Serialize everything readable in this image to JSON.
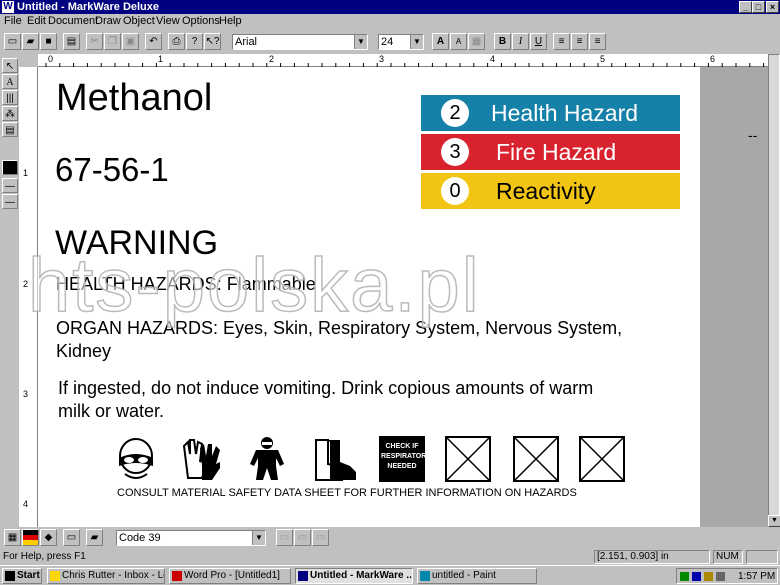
{
  "window": {
    "title": "Untitled - MarkWare Deluxe",
    "app_icon": "W"
  },
  "menu": [
    "File",
    "Edit",
    "Document",
    "Draw",
    "Object",
    "View",
    "Options",
    "Help"
  ],
  "toolbar": {
    "font": "Arial",
    "size": "24",
    "bold": "B",
    "italic": "I",
    "underline": "U"
  },
  "rulers": {
    "h_marks": [
      "0",
      "1",
      "2",
      "3",
      "4",
      "5",
      "6"
    ],
    "v_marks": [
      "1",
      "2",
      "3",
      "4"
    ]
  },
  "label": {
    "chemical": "Methanol",
    "cas": "67-56-1",
    "signal": "WARNING",
    "health": "HEALTH HAZARDS: Flammable",
    "organ_line1": "ORGAN HAZARDS: Eyes, Skin, Respiratory System, Nervous System,",
    "organ_line2": "Kidney",
    "first_aid_line1": "If ingested, do not induce vomiting.  Drink copious amounts of warm",
    "first_aid_line2": "milk or water.",
    "respirator_text": "CHECK IF RESPIRATOR NEEDED",
    "footer": "CONSULT MATERIAL SAFETY DATA SHEET FOR FURTHER INFORMATION ON HAZARDS",
    "side_mark": "--"
  },
  "hazards": [
    {
      "rating": "2",
      "label": "Health Hazard",
      "color": "#1580a8"
    },
    {
      "rating": "3",
      "label": "Fire Hazard",
      "color": "#d8222e"
    },
    {
      "rating": "0",
      "label": "Reactivity",
      "color": "#f2c514"
    }
  ],
  "barcode": {
    "symbology": "Code 39"
  },
  "status": {
    "help": "For Help, press F1",
    "coords": "[2.151, 0.903] in",
    "numlock": "NUM"
  },
  "taskbar": {
    "start": "Start",
    "tasks": [
      "Chris Rutter - Inbox - Lotus...",
      "Word Pro - [Untitled1]",
      "Untitled - MarkWare ...",
      "untitled - Paint"
    ],
    "clock": "1:57 PM"
  },
  "watermark": "hts-polska.pl"
}
